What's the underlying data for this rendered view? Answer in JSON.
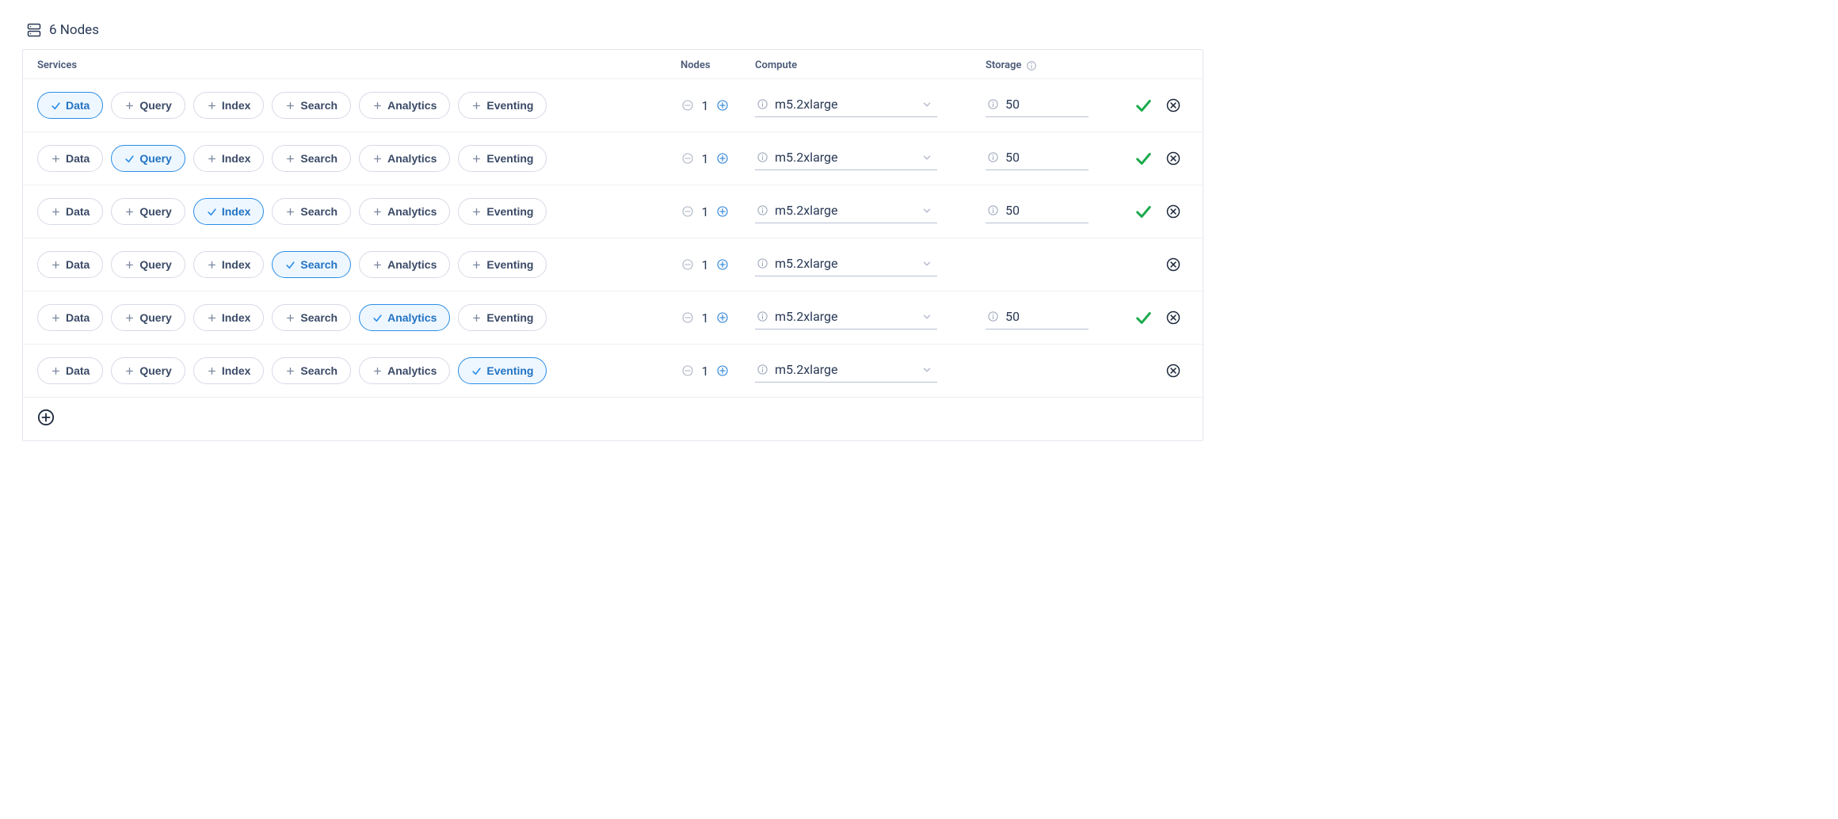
{
  "summary": {
    "label": "6 Nodes"
  },
  "headers": {
    "services": "Services",
    "nodes": "Nodes",
    "compute": "Compute",
    "storage": "Storage"
  },
  "service_labels": {
    "data": "Data",
    "query": "Query",
    "index": "Index",
    "search": "Search",
    "analytics": "Analytics",
    "eventing": "Eventing"
  },
  "rows": [
    {
      "selected": "data",
      "nodes": "1",
      "compute": "m5.2xlarge",
      "storage": "50"
    },
    {
      "selected": "query",
      "nodes": "1",
      "compute": "m5.2xlarge",
      "storage": "50"
    },
    {
      "selected": "index",
      "nodes": "1",
      "compute": "m5.2xlarge",
      "storage": "50"
    },
    {
      "selected": "search",
      "nodes": "1",
      "compute": "m5.2xlarge",
      "storage": ""
    },
    {
      "selected": "analytics",
      "nodes": "1",
      "compute": "m5.2xlarge",
      "storage": "50"
    },
    {
      "selected": "eventing",
      "nodes": "1",
      "compute": "m5.2xlarge",
      "storage": ""
    }
  ]
}
